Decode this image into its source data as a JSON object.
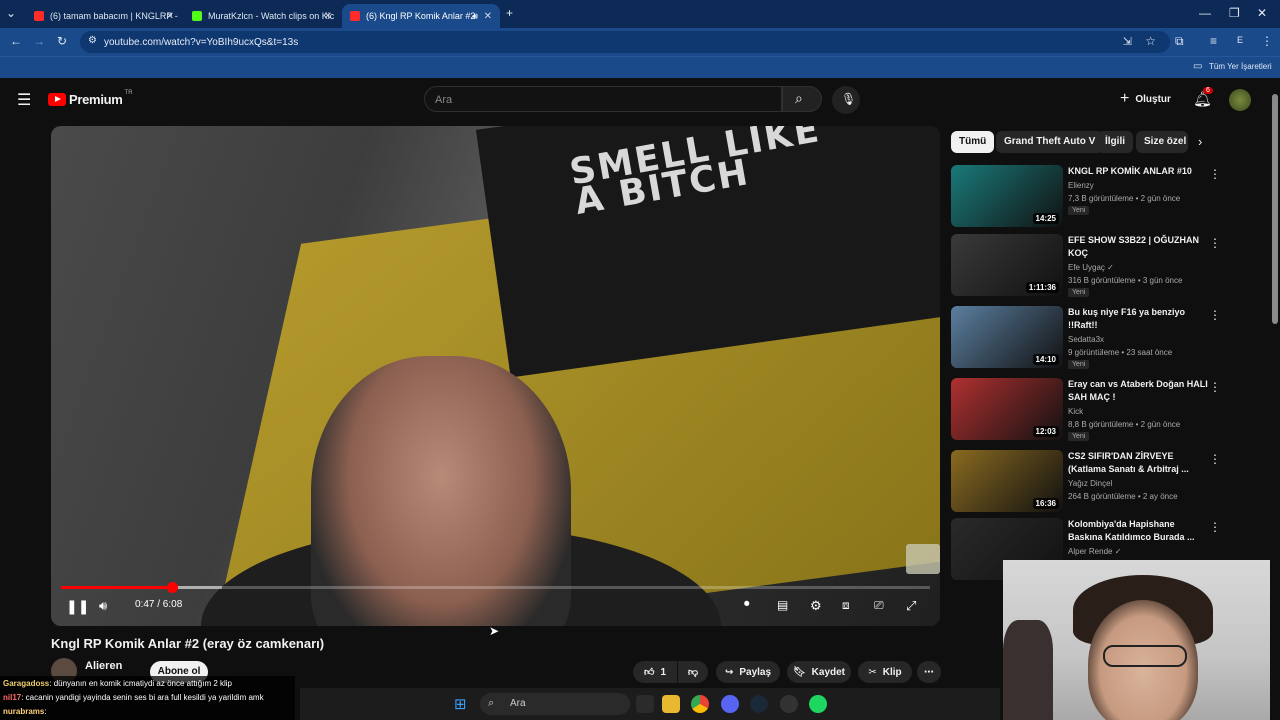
{
  "browser": {
    "tabs": [
      {
        "label": "(6) tamam babacım | KNGLRP -",
        "fav_color": "#ff2a2a"
      },
      {
        "label": "MuratKzlcn - Watch clips on Kic",
        "fav_color": "#53fc18"
      },
      {
        "label": "(6) Kngl RP Komik Anlar #2",
        "fav_color": "#ff2a2a"
      }
    ],
    "url": "youtube.com/watch?v=YoBIh9ucxQs&t=13s",
    "bookmarks_label": "Tüm Yer İşaretleri",
    "profile_initial": "E"
  },
  "youtube": {
    "logo": "Premium",
    "region": "TR",
    "search_placeholder": "Ara",
    "create_label": "Oluştur",
    "notif_count": "6"
  },
  "player": {
    "time": "0:47 / 6:08",
    "progress_fraction": 0.128,
    "buffer_fraction": 0.185,
    "overlay_text": "SMELL LIKE A BITCH"
  },
  "video": {
    "title": "Kngl RP Komik Anlar #2 (eray öz camkenarı)",
    "channel": "Alieren",
    "subscribe_label": "Abone ol",
    "like_count": "1",
    "share_label": "Paylaş",
    "save_label": "Kaydet",
    "clip_label": "Klip"
  },
  "chips": [
    "Tümü",
    "Grand Theft Auto V",
    "İlgili",
    "Size özel"
  ],
  "recommendations": [
    {
      "title": "KNGL RP KOMİK ANLAR #10",
      "channel": "Elienzy",
      "meta": "7,3 B görüntüleme • 2 gün önce",
      "badge": "Yeni",
      "duration": "14:25",
      "thumb_color": "#1a7a7a"
    },
    {
      "title": "EFE SHOW S3B22 | OĞUZHAN KOÇ",
      "channel": "Efe Uygaç ✓",
      "meta": "316 B görüntüleme • 3 gün önce",
      "badge": "Yeni",
      "duration": "1:11:36",
      "thumb_color": "#3a3a3a"
    },
    {
      "title": "Bu kuş niye F16 ya benziyo !!Raft!!",
      "channel": "Sedatta3x",
      "meta": "9 görüntüleme • 23 saat önce",
      "badge": "Yeni",
      "duration": "14:10",
      "thumb_color": "#5b7fa0"
    },
    {
      "title": "Eray can vs Ataberk Doğan HALI SAH MAÇ !",
      "channel": "Kick",
      "meta": "8,8 B görüntüleme • 2 gün önce",
      "badge": "Yeni",
      "duration": "12:03",
      "thumb_color": "#b03030"
    },
    {
      "title": "CS2 SIFIR'DAN ZİRVEYE (Katlama Sanatı & Arbitraj ...",
      "channel": "Yağız Dinçel",
      "meta": "264 B görüntüleme • 2 ay önce",
      "badge": "",
      "duration": "16:36",
      "thumb_color": "#8a6a20"
    },
    {
      "title": "Kolombiya'da Hapishane Baskına Katıldımco Burada ...",
      "channel": "Alper Rende ✓",
      "meta": "",
      "badge": "",
      "duration": "",
      "thumb_color": "#2a2a2a"
    }
  ],
  "chat": [
    {
      "user": "Garagadoss",
      "text": ": dünyanın en komik icmatiydi az önce attığım 2 klip"
    },
    {
      "user": "nil17",
      "text": ": cacanin yandigi yayinda senin ses bi ara full kesildi ya yarildim amk"
    },
    {
      "user": "nurabrams",
      "text": ":"
    }
  ],
  "taskbar": {
    "search_label": "Ara"
  }
}
